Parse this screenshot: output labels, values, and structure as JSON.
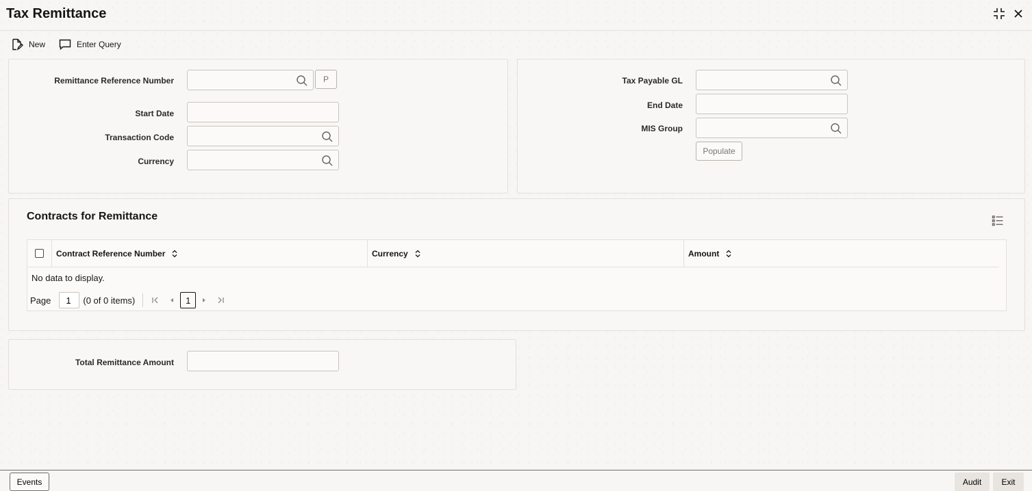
{
  "header": {
    "title": "Tax Remittance",
    "controls": [
      "collapse-icon",
      "close-icon"
    ]
  },
  "toolbar": {
    "new_label": "New",
    "enter_query_label": "Enter Query"
  },
  "main_form": {
    "remittance_reference_number": {
      "label": "Remittance Reference Number",
      "value": ""
    },
    "p_button_label": "P",
    "start_date": {
      "label": "Start Date",
      "value": ""
    },
    "transaction_code": {
      "label": "Transaction Code",
      "value": ""
    },
    "currency": {
      "label": "Currency",
      "value": ""
    },
    "tax_payable_gl": {
      "label": "Tax Payable GL",
      "value": ""
    },
    "end_date": {
      "label": "End Date",
      "value": ""
    },
    "mis_group": {
      "label": "MIS Group",
      "value": ""
    },
    "populate_label": "Populate"
  },
  "contracts": {
    "title": "Contracts for Remittance",
    "columns": [
      "Contract Reference Number",
      "Currency",
      "Amount"
    ],
    "rows": [],
    "empty_text": "No data to display.",
    "pager": {
      "page_label": "Page",
      "page_value": "1",
      "items_text": "(0 of 0 items)",
      "current_page": "1"
    }
  },
  "totals": {
    "total_remittance_amount": {
      "label": "Total Remittance Amount",
      "value": ""
    }
  },
  "footer": {
    "events_label": "Events",
    "audit_label": "Audit",
    "exit_label": "Exit"
  }
}
